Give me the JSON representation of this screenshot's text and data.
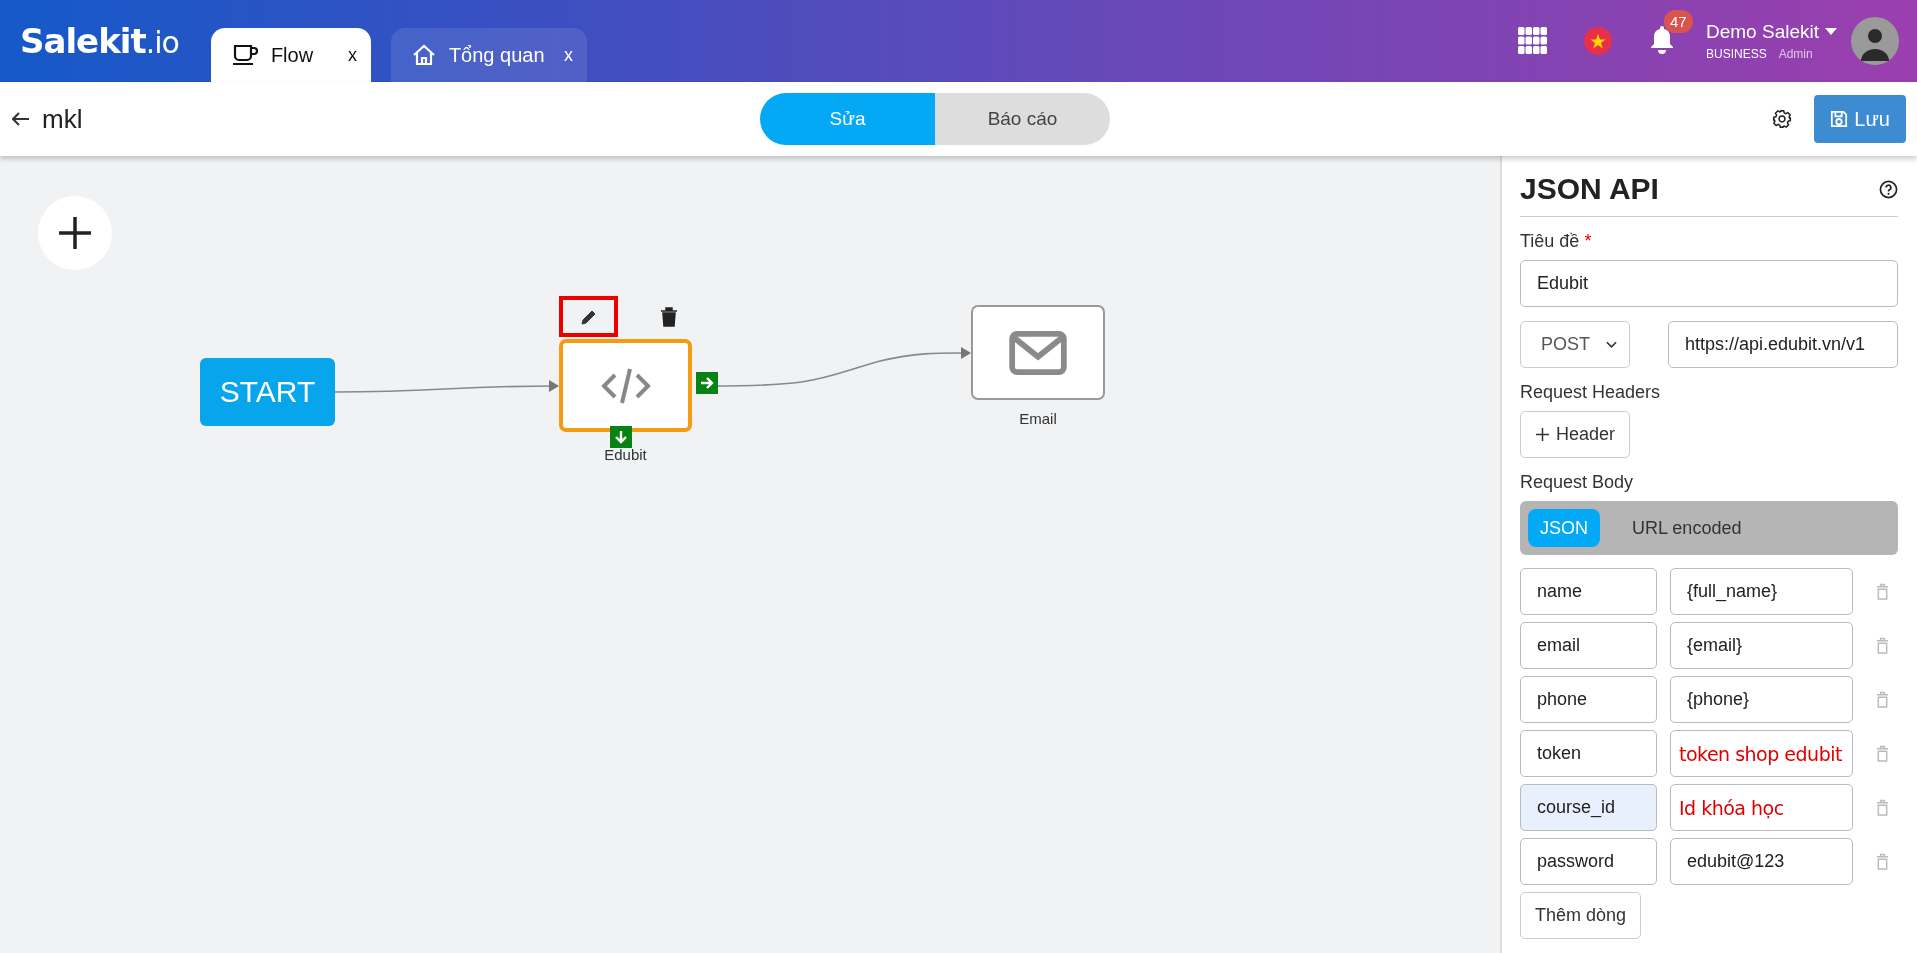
{
  "header": {
    "logo": {
      "main": "Salekit",
      "suffix": ".io"
    },
    "tabs": [
      {
        "label": "Flow",
        "close": "x",
        "selected": true
      },
      {
        "label": "Tổng quan",
        "close": "x",
        "selected": false
      }
    ],
    "notifications": "47",
    "user": {
      "name": "Demo Salekit",
      "plan": "BUSINESS",
      "role": "Admin"
    }
  },
  "toolbar": {
    "title": "mkl",
    "modes": [
      {
        "label": "Sửa",
        "selected": true
      },
      {
        "label": "Báo cáo",
        "selected": false
      }
    ],
    "save": "Lưu"
  },
  "canvas": {
    "nodes": [
      {
        "kind": "start",
        "label": "START",
        "selected": false
      },
      {
        "kind": "code",
        "label": "Edubit",
        "selected": true
      },
      {
        "kind": "email",
        "label": "Email",
        "selected": false
      }
    ]
  },
  "panel": {
    "title": "JSON API",
    "title_label": "Tiêu đề",
    "required_mark": "*",
    "title_value": "Edubit",
    "method": "POST",
    "url": "https://api.edubit.vn/v1",
    "headers_label": "Request Headers",
    "add_header": "Header",
    "body_label": "Request Body",
    "body_types": [
      {
        "label": "JSON",
        "selected": true
      },
      {
        "label": "URL encoded",
        "selected": false
      }
    ],
    "rows": [
      {
        "key": "name",
        "value": "{full_name}",
        "kind": "value",
        "highlighted": false
      },
      {
        "key": "email",
        "value": "{email}",
        "kind": "value",
        "highlighted": false
      },
      {
        "key": "phone",
        "value": "{phone}",
        "kind": "value",
        "highlighted": false
      },
      {
        "key": "token",
        "value": "token shop edubit",
        "kind": "annotation",
        "highlighted": false
      },
      {
        "key": "course_id",
        "value": "Id khóa học",
        "kind": "annotation",
        "highlighted": true
      },
      {
        "key": "password",
        "value": "edubit@123",
        "kind": "value",
        "highlighted": false
      }
    ],
    "add_row": "Thêm dòng"
  }
}
